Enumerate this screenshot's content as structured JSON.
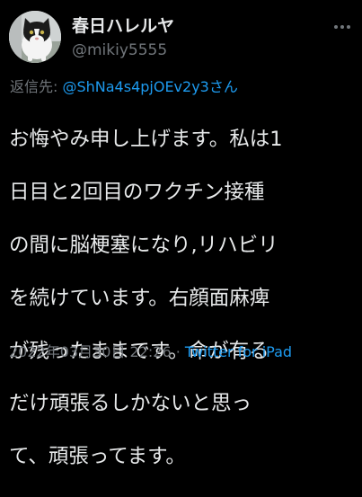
{
  "tweet": {
    "display_name": "春日ハレルヤ",
    "handle": "@mikiy5555",
    "reply_label": "返信先: ",
    "reply_user": "@ShNa4s4pjOEv2y3さん",
    "lines": [
      "お悔やみ申し上げます。私は1",
      "日目と2回目のワクチン接種",
      "の間に脳梗塞になり,リハビリ",
      "を続けています。右顔面麻痺",
      "が残ったままです。命が有る",
      "だけ頑張るしかないと思っ",
      "て、頑張ってます。"
    ],
    "timestamp": "2022年03月30日 22:26",
    "separator": " · ",
    "source": "Twitter for iPad"
  },
  "colors": {
    "background": "#000000",
    "text": "#e7e9ea",
    "secondary": "#71767b",
    "link": "#1d9bf0"
  },
  "icons": {
    "avatar": "cat-avatar",
    "more": "more-options-icon"
  }
}
